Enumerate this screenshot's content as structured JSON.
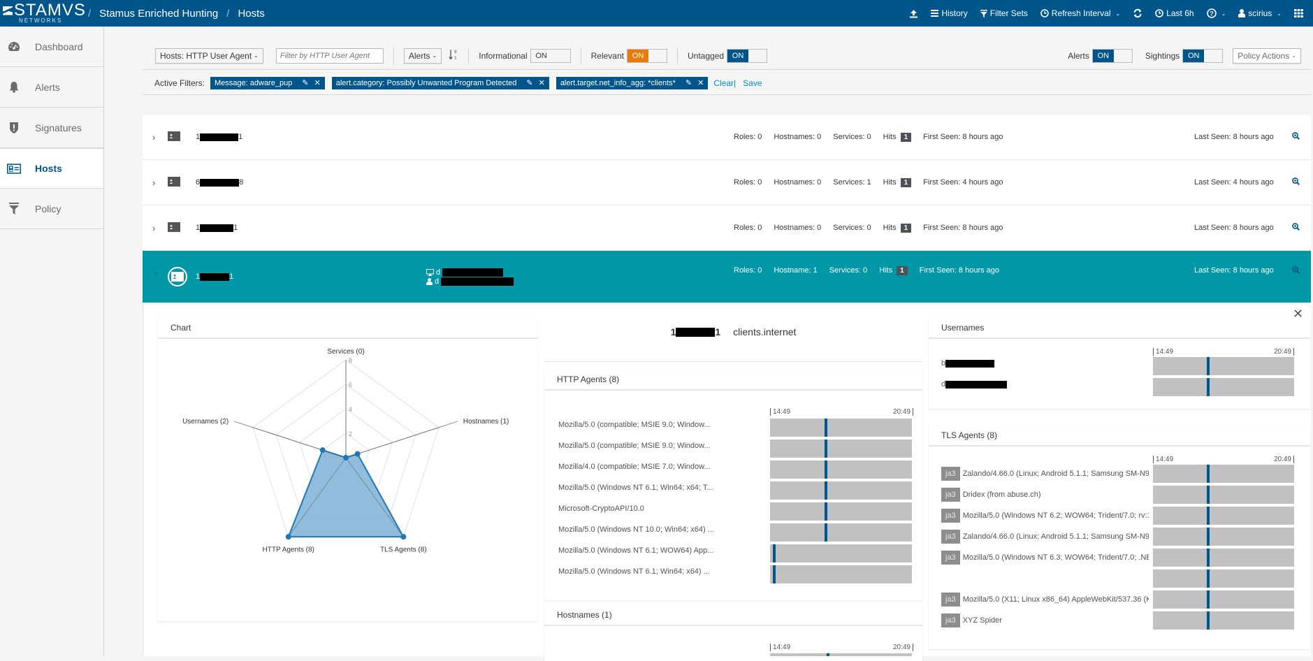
{
  "topbar": {
    "logo_main": "STAMVS",
    "logo_sub": "NETWORKS",
    "breadcrumb": [
      "Stamus Enriched Hunting",
      "Hosts"
    ],
    "nav": {
      "history": "History",
      "filter_sets": "Filter Sets",
      "refresh_interval": "Refresh Interval",
      "time_range": "Last 6h",
      "user": "scirius"
    }
  },
  "sidebar": {
    "items": [
      {
        "label": "Dashboard",
        "icon": "dashboard-icon"
      },
      {
        "label": "Alerts",
        "icon": "bell-icon"
      },
      {
        "label": "Signatures",
        "icon": "shield-icon"
      },
      {
        "label": "Hosts",
        "icon": "id-card-icon",
        "active": true
      },
      {
        "label": "Policy",
        "icon": "filter-icon"
      }
    ]
  },
  "toolbar": {
    "hosts_select": "Hosts: HTTP User Agent",
    "filter_placeholder": "Filter by HTTP User Agent",
    "sort_select": "Alerts",
    "toggles": {
      "informational": {
        "label": "Informational",
        "value": "ON"
      },
      "relevant": {
        "label": "Relevant",
        "value": "ON"
      },
      "untagged": {
        "label": "Untagged",
        "value": "ON"
      },
      "alerts": {
        "label": "Alerts",
        "value": "ON"
      },
      "sightings": {
        "label": "Sightings",
        "value": "ON"
      }
    },
    "policy_actions": "Policy Actions"
  },
  "filters": {
    "label": "Active Filters:",
    "chips": [
      "Message: adware_pup",
      "alert.category: Possibly Unwanted Program Detected",
      "alert.target.net_info_agg: *clients*"
    ],
    "clear": "Clear",
    "clear_sep": "|",
    "save": "Save"
  },
  "hosts": [
    {
      "ip_prefix": "1",
      "ip_suffix": "1",
      "roles": "Roles: 0",
      "hostnames": "Hostnames: 0",
      "services": "Services: 0",
      "hits_label": "Hits",
      "hits": "1",
      "first_seen": "First Seen: 8 hours ago",
      "last_seen": "Last Seen: 8 hours ago"
    },
    {
      "ip_prefix": "6",
      "ip_suffix": "8",
      "roles": "Roles: 0",
      "hostnames": "Hostnames: 0",
      "services": "Services: 1",
      "hits_label": "Hits",
      "hits": "1",
      "first_seen": "First Seen: 4 hours ago",
      "last_seen": "Last Seen: 4 hours ago"
    },
    {
      "ip_prefix": "1",
      "ip_suffix": "1",
      "roles": "Roles: 0",
      "hostnames": "Hostnames: 0",
      "services": "Services: 0",
      "hits_label": "Hits",
      "hits": "1",
      "first_seen": "First Seen: 8 hours ago",
      "last_seen": "Last Seen: 8 hours ago"
    },
    {
      "ip_prefix": "1",
      "ip_suffix": "1",
      "hostname_prefix": "d",
      "username_prefix": "d",
      "roles": "Roles: 0",
      "hostnames": "Hostname: 1",
      "services": "Services: 0",
      "hits_label": "Hits",
      "hits": "1",
      "first_seen": "First Seen: 8 hours ago",
      "last_seen": "Last Seen: 8 hours ago",
      "expanded": true
    }
  ],
  "detail": {
    "chart_title": "Chart",
    "ip_prefix": "1",
    "ip_suffix": "1",
    "net_info": "clients.internet",
    "time_start": "14:49",
    "time_end": "20:49",
    "http_agents": {
      "title": "HTTP Agents (8)",
      "items": [
        {
          "label": "Mozilla/5.0 (compatible; MSIE 9.0; Window...",
          "position": 0.39
        },
        {
          "label": "Mozilla/5.0 (compatible; MSIE 9.0; Window...",
          "position": 0.39
        },
        {
          "label": "Mozilla/4.0 (compatible; MSIE 7.0; Window...",
          "position": 0.39
        },
        {
          "label": "Mozilla/5.0 (Windows NT 6.1; Win64; x64; T...",
          "position": 0.39
        },
        {
          "label": "Microsoft-CryptoAPI/10.0",
          "position": 0.39
        },
        {
          "label": "Mozilla/5.0 (Windows NT 10.0; Win64; x64) ...",
          "position": 0.39
        },
        {
          "label": "Mozilla/5.0 (Windows NT 6.1; WOW64) App...",
          "position": 0.02
        },
        {
          "label": "Mozilla/5.0 (Windows NT 6.1; Win64; x64) ...",
          "position": 0.02
        }
      ]
    },
    "hostnames": {
      "title": "Hostnames (1)"
    },
    "usernames": {
      "title": "Usernames",
      "items": [
        {
          "prefix": "b",
          "position": 0.39
        },
        {
          "prefix": "d",
          "position": 0.39
        }
      ]
    },
    "tls_agents": {
      "title": "TLS Agents (8)",
      "badge": "ja3",
      "items": [
        {
          "label": "Zalando/4.66.0 (Linux; Android 5.1.1; Samsung SM-N9",
          "position": 0.39
        },
        {
          "label": "Dridex (from abuse.ch)",
          "position": 0.39
        },
        {
          "label": "Mozilla/5.0 (Windows NT 6.2; WOW64; Trident/7.0; rv:1",
          "position": 0.39
        },
        {
          "label": "Zalando/4.66.0 (Linux; Android 5.1.1; Samsung SM-N9",
          "position": 0.39
        },
        {
          "label": "Mozilla/5.0 (Windows NT 6.3; WOW64; Trident/7.0; .NE",
          "position": 0.39
        },
        {
          "label": "",
          "position": 0.39
        },
        {
          "label": "Mozilla/5.0 (X11; Linux x86_64) AppleWebKit/537.36 (K",
          "position": 0.39
        },
        {
          "label": "XYZ Spider",
          "position": 0.39
        }
      ]
    }
  },
  "chart_data": {
    "type": "radar",
    "title": "Chart",
    "categories": [
      "Services (0)",
      "Hostnames (1)",
      "TLS Agents (8)",
      "HTTP Agents (8)",
      "Usernames (2)"
    ],
    "values": [
      0,
      1,
      8,
      8,
      2
    ],
    "ticks": [
      2,
      4,
      6,
      8
    ],
    "range": [
      0,
      8
    ],
    "color": "#1f77b4",
    "fill": "#7fb0d5"
  }
}
